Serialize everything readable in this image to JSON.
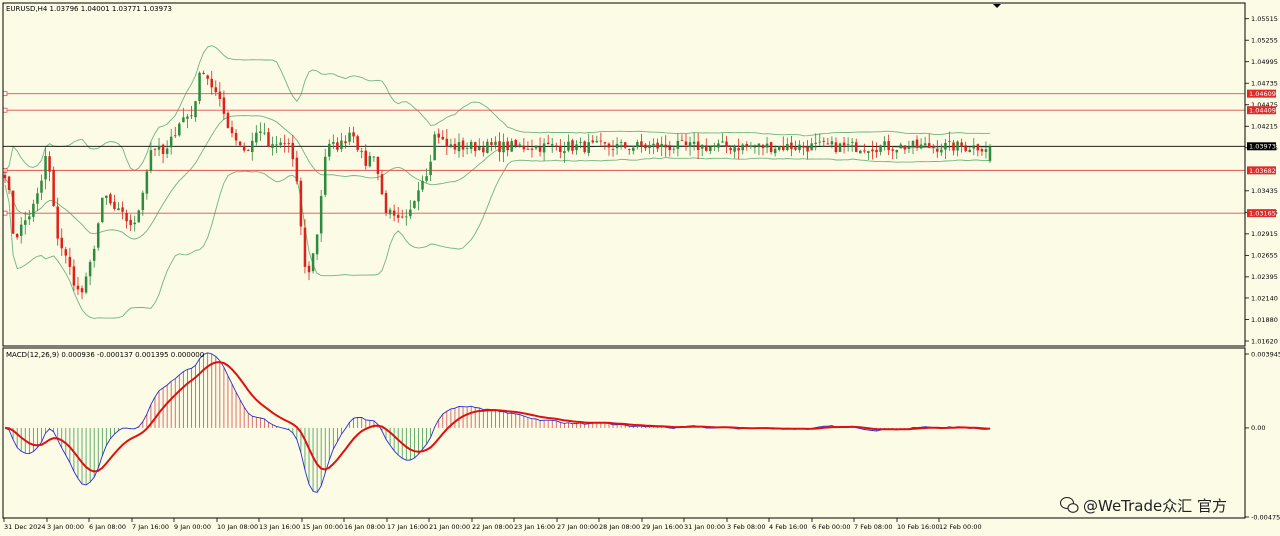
{
  "chart_data": {
    "type": "candlestick",
    "title": "EURUSD,H4  1.03796 1.04001 1.03771 1.03973",
    "symbol": "EURUSD",
    "timeframe": "H4",
    "ohlc_now": {
      "open": 1.03796,
      "high": 1.04001,
      "low": 1.03771,
      "close": 1.03973
    },
    "price_ylim": [
      1.0162,
      1.0562
    ],
    "price_ticks": [
      "1.05515",
      "1.05255",
      "1.04995",
      "1.04735",
      "1.04475",
      "1.04215",
      "1.03955",
      "1.03435",
      "1.03175",
      "1.02915",
      "1.02655",
      "1.02395",
      "1.02140",
      "1.01880",
      "1.01620"
    ],
    "x_labels": [
      "31 Dec 2024",
      "3 Jan 00:00",
      "6 Jan 08:00",
      "7 Jan 16:00",
      "9 Jan 00:00",
      "10 Jan 08:00",
      "13 Jan 16:00",
      "15 Jan 00:00",
      "16 Jan 08:00",
      "17 Jan 16:00",
      "21 Jan 00:00",
      "22 Jan 08:00",
      "23 Jan 16:00",
      "27 Jan 00:00",
      "28 Jan 08:00",
      "29 Jan 16:00",
      "31 Jan 00:00",
      "3 Feb 08:00",
      "4 Feb 16:00",
      "6 Feb 00:00",
      "7 Feb 08:00",
      "10 Feb 16:00",
      "12 Feb 00:00"
    ],
    "bar_count": 244,
    "key_points": [
      [
        0,
        1.0392
      ],
      [
        8,
        1.035
      ],
      [
        14,
        1.0285
      ],
      [
        24,
        1.0305
      ],
      [
        32,
        1.032
      ],
      [
        40,
        1.0345
      ],
      [
        47,
        1.0393
      ],
      [
        56,
        1.0295
      ],
      [
        68,
        1.0255
      ],
      [
        80,
        1.0215
      ],
      [
        88,
        1.024
      ],
      [
        96,
        1.029
      ],
      [
        104,
        1.034
      ],
      [
        112,
        1.0323
      ],
      [
        122,
        1.0313
      ],
      [
        135,
        1.03
      ],
      [
        152,
        1.04
      ],
      [
        165,
        1.0385
      ],
      [
        180,
        1.043
      ],
      [
        192,
        1.0435
      ],
      [
        202,
        1.0495
      ],
      [
        216,
        1.046
      ],
      [
        230,
        1.0418
      ],
      [
        246,
        1.039
      ],
      [
        260,
        1.042
      ],
      [
        270,
        1.0393
      ],
      [
        280,
        1.04
      ],
      [
        290,
        1.04
      ],
      [
        298,
        1.034
      ],
      [
        306,
        1.0235
      ],
      [
        316,
        1.028
      ],
      [
        326,
        1.0395
      ],
      [
        342,
        1.04
      ],
      [
        352,
        1.042
      ],
      [
        364,
        1.0375
      ],
      [
        374,
        1.039
      ],
      [
        384,
        1.0325
      ],
      [
        396,
        1.0305
      ],
      [
        408,
        1.0307
      ],
      [
        418,
        1.035
      ],
      [
        428,
        1.037
      ],
      [
        436,
        1.0418
      ],
      [
        445,
        1.0397
      ]
    ],
    "horizontal_levels": [
      {
        "value": 1.04609,
        "label": "1.04609"
      },
      {
        "value": 1.04409,
        "label": "1.04409"
      },
      {
        "value": 1.03682,
        "label": "1.03682"
      },
      {
        "value": 1.03165,
        "label": "1.03165"
      }
    ],
    "current_price": {
      "value": 1.03973,
      "label": "1.03973"
    },
    "indicator": {
      "name": "MACD(12,26,9) 0.000936 -0.000137 0.001395 0.000000",
      "ylim": [
        -0.004754,
        0.003945
      ],
      "ticks": [
        "0.003945",
        "0.00",
        "-0.004754"
      ]
    },
    "colors": {
      "background": "#fbfbe6",
      "bull": "#2e8b3e",
      "bear": "#e0201a",
      "bands": "#6fb57e",
      "levels": "#e05050",
      "macd_line": "#2b2bd6",
      "signal_line": "#e01010"
    }
  },
  "watermark": "@WeTrade众汇 官方",
  "watermark_icon": "wechat-icon"
}
